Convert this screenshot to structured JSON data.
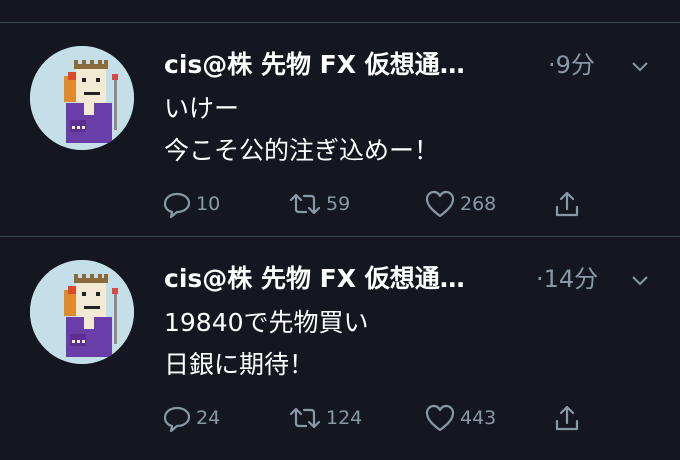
{
  "tweets": [
    {
      "author": "cis@株 先物 FX 仮想通…",
      "time": "·9分",
      "lines": [
        "いけー",
        "今こそ公的注ぎ込めー！"
      ],
      "replies": "10",
      "retweets": "59",
      "likes": "268"
    },
    {
      "author": "cis@株 先物 FX 仮想通…",
      "time": "·14分",
      "lines": [
        "19840で先物買い",
        "日銀に期待！"
      ],
      "replies": "24",
      "retweets": "124",
      "likes": "443"
    }
  ],
  "icons": [
    "chevron-down-icon",
    "reply-icon",
    "retweet-icon",
    "like-icon",
    "share-icon"
  ],
  "colors": {
    "background": "#14171f",
    "divider": "#38444d",
    "muted": "#8899a6",
    "avatar_bg": "#c5dfe8",
    "avatar_robe": "#6a3ea8"
  }
}
